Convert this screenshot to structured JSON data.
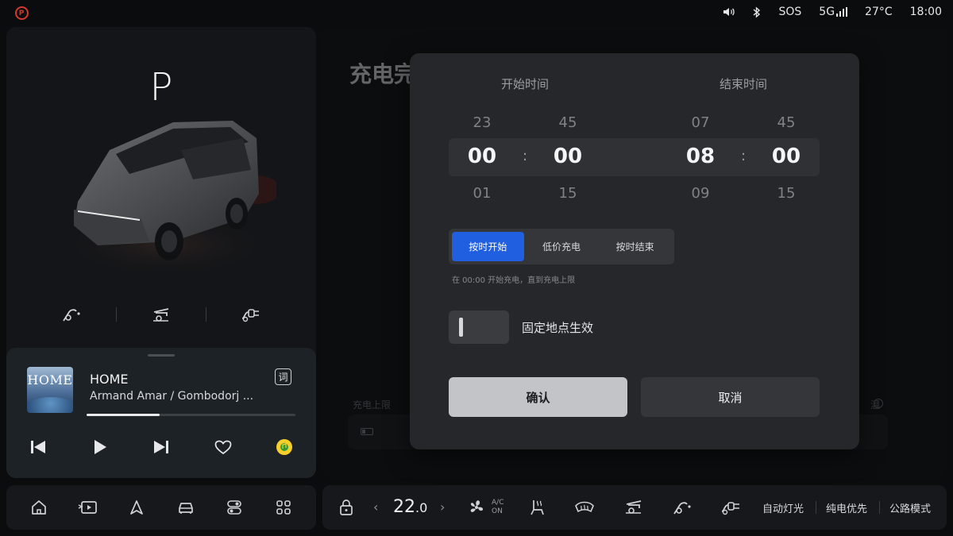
{
  "status_bar": {
    "brake_icon": "parking-brake-icon",
    "items": [
      "SOS",
      "5G",
      "27°C",
      "18:00"
    ],
    "volume_icon": "volume-icon",
    "bluetooth_icon": "bluetooth-icon",
    "signal_icon": "signal-bars-icon"
  },
  "vehicle": {
    "gear": "P",
    "controls": [
      "charge-port-icon",
      "trunk-icon",
      "charger-icon"
    ]
  },
  "media": {
    "album_art_text": "HOME",
    "title": "HOME",
    "artist": "Armand Amar / Gombodorj ...",
    "lyrics_label": "词",
    "progress": 0.35,
    "controls": [
      "previous-icon",
      "play-icon",
      "next-icon",
      "heart-icon",
      "music-app-icon"
    ]
  },
  "main": {
    "title": "充电完",
    "left_label": "充电上限",
    "right_label": "温"
  },
  "dialog": {
    "start_label": "开始时间",
    "end_label": "结束时间",
    "start_picker": {
      "hour_prev": "23",
      "hour": "00",
      "hour_next": "01",
      "minute_prev": "45",
      "minute": "00",
      "minute_next": "15"
    },
    "end_picker": {
      "hour_prev": "07",
      "hour": "08",
      "hour_next": "09",
      "minute_prev": "45",
      "minute": "00",
      "minute_next": "15"
    },
    "colon": ":",
    "modes": [
      "按时开始",
      "低价充电",
      "按时结束"
    ],
    "active_mode": 0,
    "hint": "在 00:00 开始充电，直到充电上限",
    "toggle_label": "固定地点生效",
    "toggle_on": false,
    "confirm": "确认",
    "cancel": "取消"
  },
  "dock": {
    "icons": [
      "home-icon",
      "media-icon",
      "navigation-icon",
      "car-icon",
      "toggle-settings-icon",
      "apps-grid-icon"
    ]
  },
  "climate_bar": {
    "temperature": "22",
    "temperature_decimal": ".0",
    "left_arrow": "‹",
    "right_arrow": "›",
    "ac_top": "A/C",
    "ac_bottom": "ON",
    "auto_light": "自动灯光",
    "ev_priority": "纯电优先",
    "road_mode": "公路模式"
  },
  "colors": {
    "accent": "#1f5fe0",
    "brake_red": "#d23a30",
    "panel": "#17181b",
    "dialog": "#25272b",
    "music_yellow": "#f6cf2b"
  }
}
